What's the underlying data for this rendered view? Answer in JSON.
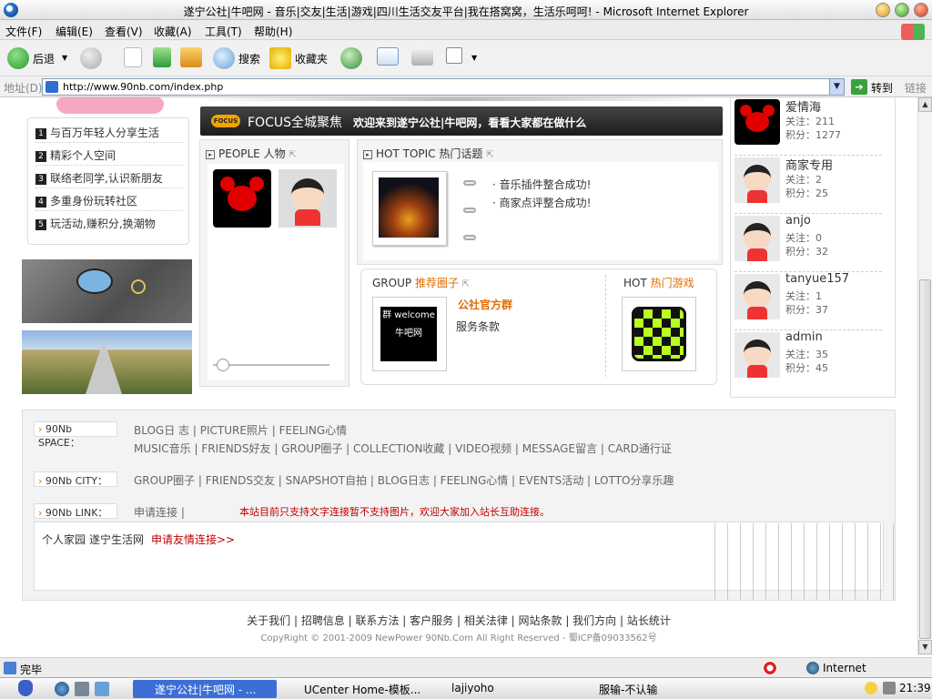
{
  "window": {
    "title": "遂宁公社|牛吧网 - 音乐|交友|生活|游戏|四川生活交友平台|我在搭窝窝，生活乐呵呵! - Microsoft Internet Explorer"
  },
  "menu": [
    "文件(F)",
    "编辑(E)",
    "查看(V)",
    "收藏(A)",
    "工具(T)",
    "帮助(H)"
  ],
  "toolbar": {
    "back": "后退",
    "search": "搜索",
    "favorites": "收藏夹"
  },
  "address": {
    "label": "地址(D)",
    "url": "http://www.90nb.com/index.php",
    "go": "转到",
    "links": "链接"
  },
  "left_menu": [
    {
      "num": "1",
      "label": "与百万年轻人分享生活"
    },
    {
      "num": "2",
      "label": "精彩个人空间"
    },
    {
      "num": "3",
      "label": "联络老同学,认识新朋友"
    },
    {
      "num": "4",
      "label": "多重身份玩转社区"
    },
    {
      "num": "5",
      "label": "玩活动,赚积分,换潮物"
    }
  ],
  "focus": {
    "badge": "FOCUS",
    "title": "FOCUS全城聚焦",
    "message": "欢迎来到遂宁公社|牛吧网，看看大家都在做什么"
  },
  "people": {
    "header": "PEOPLE 人物"
  },
  "hot_topic": {
    "header": "HOT TOPIC 热门话题",
    "items": [
      "音乐插件整合成功!",
      "商家点评整合成功!"
    ]
  },
  "group": {
    "header_en": "GROUP",
    "header_cn": "推荐圈子",
    "name": "公社官方群",
    "desc": "服务条款",
    "logo_text": "群 welcome 牛吧网"
  },
  "hot_game": {
    "header_en": "HOT",
    "header_cn": "热门游戏"
  },
  "users": [
    {
      "name": "爱情海",
      "follow": "关注：211",
      "score": "积分：1277",
      "avatar": "mickey"
    },
    {
      "name": "商家专用",
      "follow": "关注：2",
      "score": "积分：25",
      "avatar": "kid"
    },
    {
      "name": "anjo",
      "follow": "关注：0",
      "score": "积分：32",
      "avatar": "kid"
    },
    {
      "name": "tanyue157",
      "follow": "关注：1",
      "score": "积分：37",
      "avatar": "kid"
    },
    {
      "name": "admin",
      "follow": "关注：35",
      "score": "积分：45",
      "avatar": "kid"
    }
  ],
  "footer": {
    "space_tag": "90Nb SPACE：",
    "space_line1": "BLOG日 志  |  PICTURE照片  |  FEELING心情",
    "space_line2": "MUSIC音乐  |  FRIENDS好友  |  GROUP圈子  |  COLLECTION收藏  |  VIDEO视频  |  MESSAGE留言  |  CARD通行证",
    "city_tag": "90Nb CITY：",
    "city_line": "GROUP圈子  |  FRIENDS交友  |  SNAPSHOT自拍  |  BLOG日志  |  FEELING心情  |  EVENTS活动  |  LOTTO分享乐趣",
    "link_tag": "90Nb LINK：",
    "link_line": "申请连接  |",
    "link_notice": "本站目前只支持文字连接暂不支持图片，欢迎大家加入站长互助连接。",
    "links": [
      "个人家园",
      "遂宁生活网"
    ],
    "apply_link": "申请友情连接>>"
  },
  "bottom_links": "关于我们  |  招聘信息  |  联系方法  |  客户服务  |  相关法律  |  网站条款  |  我们方向  |  站长统计",
  "copyright": "CopyRight © 2001-2009 NewPower 90Nb.Com All Right Reserved - 蜀ICP备09033562号",
  "status": {
    "text": "完毕",
    "zone": "Internet"
  },
  "taskbar": {
    "items": [
      "遂宁公社|牛吧网 - ...",
      "UCenter Home-模板...",
      "lajiyoho",
      "服输-不认输"
    ],
    "clock": "21:39"
  },
  "colors": {
    "accent": "#e26c00",
    "notice": "#c00000",
    "focus_bg": "#1c1c1c"
  }
}
